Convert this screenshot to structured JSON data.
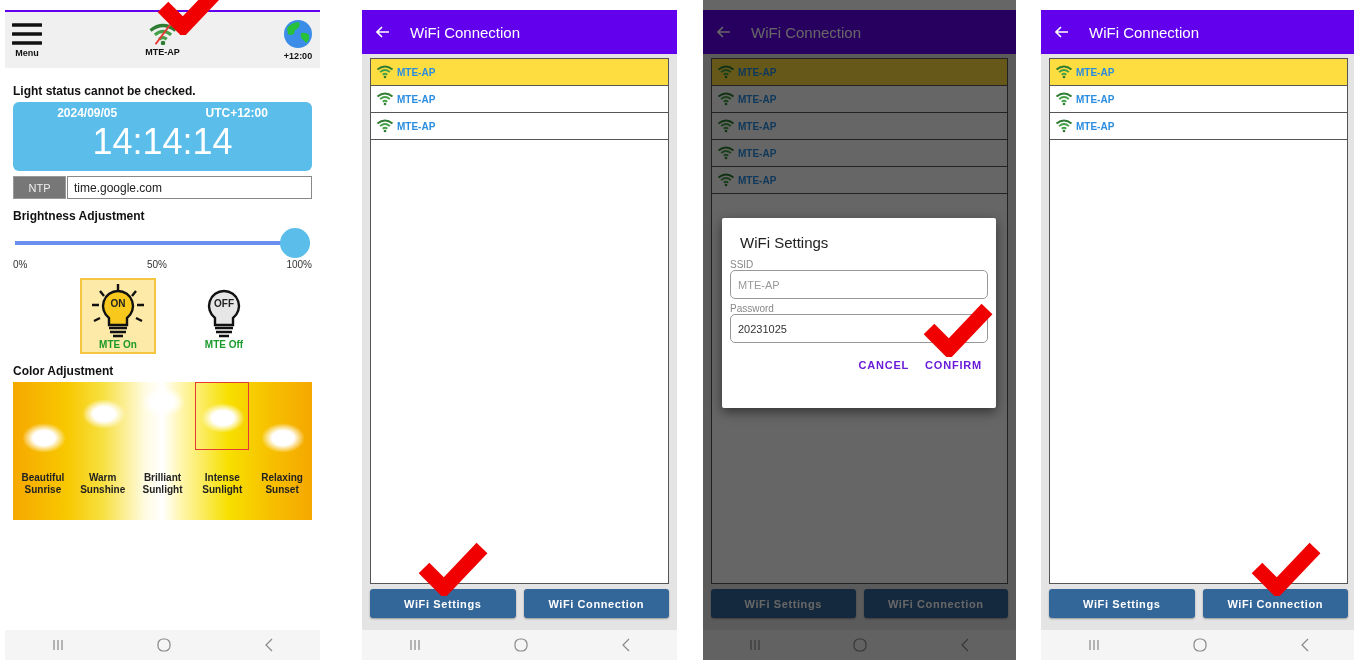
{
  "screens": [
    {
      "kind": "home",
      "header": {
        "menu_label": "Menu",
        "network": "MTE-AP",
        "connected": false,
        "check_mark": true,
        "timezone": "+12:00"
      },
      "status": "Light status cannot be checked.",
      "clock": {
        "date": "2024/09/05",
        "zone": "UTC+12:00",
        "time": "14:14:14"
      },
      "ntp": {
        "label": "NTP",
        "value": "time.google.com"
      },
      "brightness": {
        "title": "Brightness Adjustment",
        "level": 1,
        "ticks": [
          "0%",
          "50%",
          "100%"
        ]
      },
      "lights": [
        {
          "kind": "on",
          "badge": "ON",
          "label": "MTE On",
          "selected": true
        },
        {
          "kind": "off",
          "badge": "OFF",
          "label": "MTE Off",
          "selected": false
        }
      ],
      "color": {
        "title": "Color Adjustment",
        "presets": [
          {
            "label": "Beautiful Sunrise",
            "selected": false
          },
          {
            "label": "Warm Sunshine",
            "selected": false
          },
          {
            "label": "Brilliant Sunlight",
            "selected": false
          },
          {
            "label": "Intense Sunlight",
            "selected": true
          },
          {
            "label": "Relaxing Sunset",
            "selected": false
          }
        ]
      }
    },
    {
      "kind": "wifi",
      "title": "WiFi Connection",
      "networks": [
        {
          "ssid": "MTE-AP",
          "selected": true
        },
        {
          "ssid": "MTE-AP",
          "selected": false
        },
        {
          "ssid": "MTE-AP",
          "selected": false
        }
      ],
      "buttons": [
        {
          "label": "WiFi Settings",
          "check_mark": true
        },
        {
          "label": "WiFi Connection",
          "check_mark": false
        }
      ]
    },
    {
      "kind": "wifi",
      "title": "WiFi Connection",
      "networks": [
        {
          "ssid": "MTE-AP",
          "selected": true
        },
        {
          "ssid": "MTE-AP",
          "selected": false
        },
        {
          "ssid": "MTE-AP",
          "selected": false
        },
        {
          "ssid": "MTE-AP",
          "selected": false
        },
        {
          "ssid": "MTE-AP",
          "selected": false
        }
      ],
      "buttons": [
        {
          "label": "WiFi Settings",
          "check_mark": false
        },
        {
          "label": "WiFi Connection",
          "check_mark": false
        }
      ],
      "dialog": {
        "title": "WiFi Settings",
        "fields": [
          {
            "label": "SSID",
            "placeholder": "MTE-AP"
          },
          {
            "label": "Password",
            "value": "20231025"
          }
        ],
        "actions": [
          {
            "label": "CANCEL",
            "check_mark": false
          },
          {
            "label": "CONFIRM",
            "check_mark": true
          }
        ]
      }
    },
    {
      "kind": "wifi",
      "title": "WiFi Connection",
      "networks": [
        {
          "ssid": "MTE-AP",
          "selected": true
        },
        {
          "ssid": "MTE-AP",
          "selected": false
        },
        {
          "ssid": "MTE-AP",
          "selected": false
        }
      ],
      "buttons": [
        {
          "label": "WiFi Settings",
          "check_mark": false
        },
        {
          "label": "WiFi Connection",
          "check_mark": true
        }
      ]
    }
  ]
}
